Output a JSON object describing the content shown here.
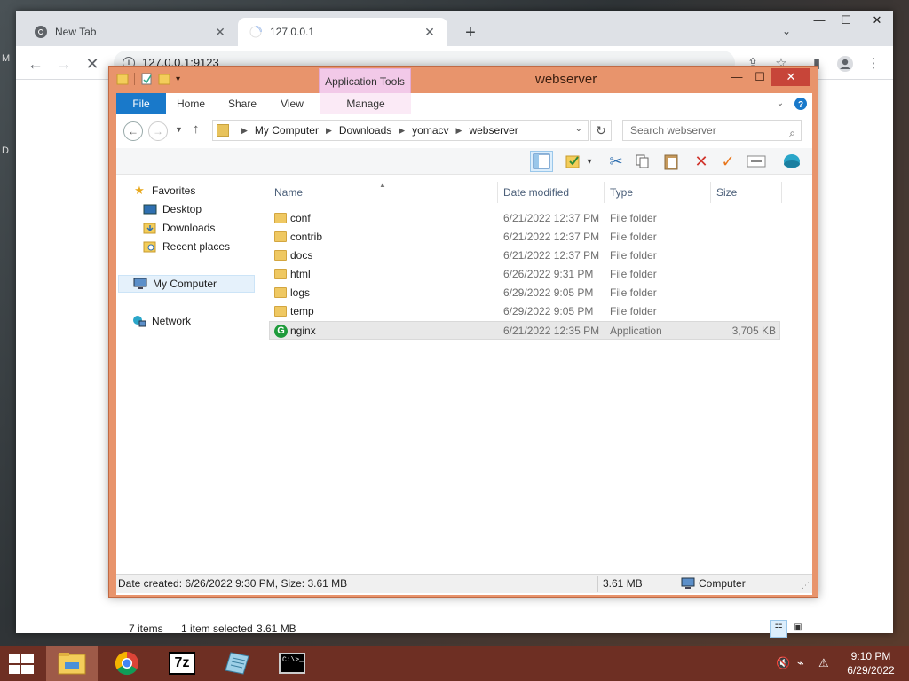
{
  "browser": {
    "tabs": [
      {
        "title": "New Tab",
        "icon": "chrome-icon"
      },
      {
        "title": "127.0.0.1",
        "icon": "loading-icon"
      }
    ],
    "new_tab_label": "+",
    "url": "127.0.0.1:9123"
  },
  "explorer": {
    "title": "webserver",
    "contextual_tab_group": "Application Tools",
    "ribbon_tabs": [
      "File",
      "Home",
      "Share",
      "View",
      "Manage"
    ],
    "breadcrumb": [
      "My Computer",
      "Downloads",
      "yomacv",
      "webserver"
    ],
    "search_placeholder": "Search webserver",
    "nav_pane": {
      "favorites": "Favorites",
      "favorites_items": [
        "Desktop",
        "Downloads",
        "Recent places"
      ],
      "computer": "My Computer",
      "network": "Network"
    },
    "columns": [
      "Name",
      "Date modified",
      "Type",
      "Size"
    ],
    "files": [
      {
        "name": "conf",
        "date": "6/21/2022 12:37 PM",
        "type": "File folder",
        "size": "",
        "kind": "folder"
      },
      {
        "name": "contrib",
        "date": "6/21/2022 12:37 PM",
        "type": "File folder",
        "size": "",
        "kind": "folder"
      },
      {
        "name": "docs",
        "date": "6/21/2022 12:37 PM",
        "type": "File folder",
        "size": "",
        "kind": "folder"
      },
      {
        "name": "html",
        "date": "6/26/2022 9:31 PM",
        "type": "File folder",
        "size": "",
        "kind": "folder"
      },
      {
        "name": "logs",
        "date": "6/29/2022 9:05 PM",
        "type": "File folder",
        "size": "",
        "kind": "folder"
      },
      {
        "name": "temp",
        "date": "6/29/2022 9:05 PM",
        "type": "File folder",
        "size": "",
        "kind": "folder"
      },
      {
        "name": "nginx",
        "date": "6/21/2022 12:35 PM",
        "type": "Application",
        "size": "3,705 KB",
        "kind": "app",
        "selected": true
      }
    ],
    "status": {
      "item_count": "7 items",
      "selection": "1 item selected",
      "selection_size": "3.61 MB",
      "details": "Date created: 6/26/2022 9:30 PM, Size: 3.61 MB",
      "size": "3.61 MB",
      "location": "Computer"
    }
  },
  "taskbar": {
    "apps": [
      "file-explorer",
      "chrome",
      "7-zip",
      "notepad",
      "command-prompt"
    ],
    "seven_zip_label": "7z",
    "cmd_label": "C:\\>_",
    "time": "9:10 PM",
    "date": "6/29/2022"
  },
  "colors": {
    "explorer_frame": "#e8946c",
    "taskbar": "#6e2f23",
    "ribbon_file": "#1979ca",
    "close_button": "#c74539"
  }
}
